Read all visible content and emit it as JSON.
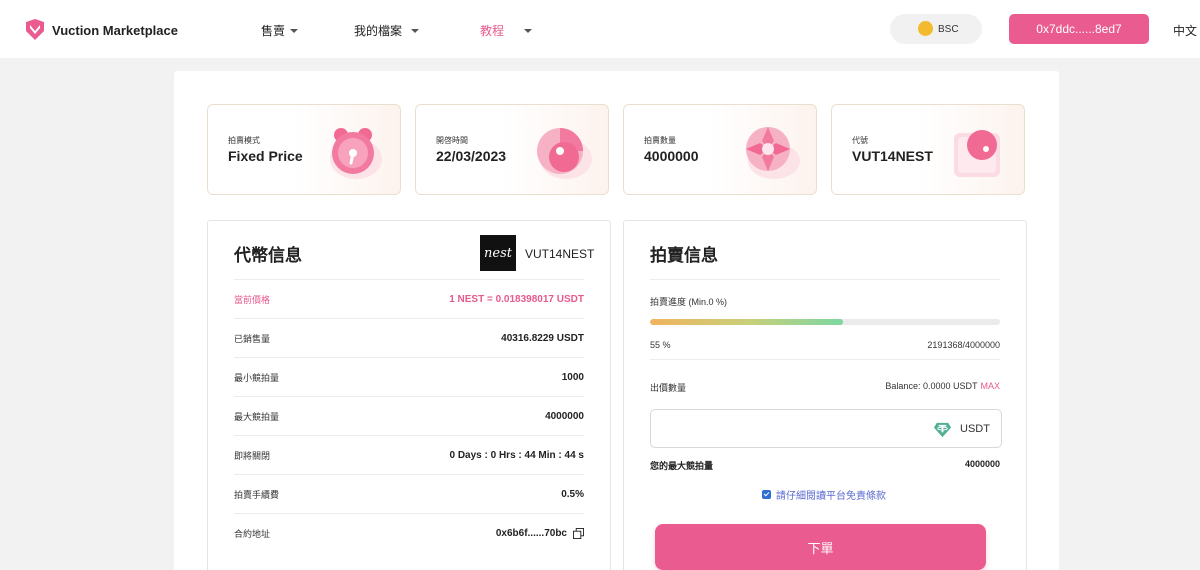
{
  "header": {
    "brand": "Vuction Marketplace",
    "nav": [
      {
        "label": "售賣"
      },
      {
        "label": "我的檔案"
      },
      {
        "label": "教程"
      }
    ],
    "network": "BSC",
    "wallet": "0x7ddc......8ed7",
    "language": "中文"
  },
  "stats": [
    {
      "label": "拍賣模式",
      "value": "Fixed Price"
    },
    {
      "label": "開啓時間",
      "value": "22/03/2023"
    },
    {
      "label": "拍賣數量",
      "value": "4000000"
    },
    {
      "label": "代號",
      "value": "VUT14NEST"
    }
  ],
  "token_info": {
    "title": "代幣信息",
    "logo_text": "nest",
    "token_name": "VUT14NEST",
    "rows": [
      {
        "label": "當前價格",
        "value": "1 NEST = 0.018398017 USDT"
      },
      {
        "label": "已銷售量",
        "value": "40316.8229 USDT"
      },
      {
        "label": "最小競拍量",
        "value": "1000"
      },
      {
        "label": "最大競拍量",
        "value": "4000000"
      },
      {
        "label": "即將關閉",
        "value": "0 Days : 0 Hrs : 44 Min : 44 s"
      },
      {
        "label": "拍賣手續費",
        "value": "0.5%"
      },
      {
        "label": "合約地址",
        "value": "0x6b6f......70bc"
      }
    ]
  },
  "auction_info": {
    "title": "拍賣信息",
    "progress_label": "拍賣進度 (Min.0 %)",
    "progress_percent": 55,
    "progress_text": "55 %",
    "progress_count": "2191368/4000000",
    "bid_label": "出價數量",
    "balance_text": "Balance: 0.0000 USDT",
    "max_label": "MAX",
    "input_value": "",
    "input_placeholder": "",
    "currency": "USDT",
    "your_max_label": "您的最大競拍量",
    "your_max_value": "4000000",
    "terms_text": "請仔細閱讀平台免責條款",
    "terms_checked": true,
    "submit_label": "下單"
  },
  "colors": {
    "accent": "#ea5b8f",
    "bsc": "#f3ba2f",
    "usdt": "#50af95"
  }
}
